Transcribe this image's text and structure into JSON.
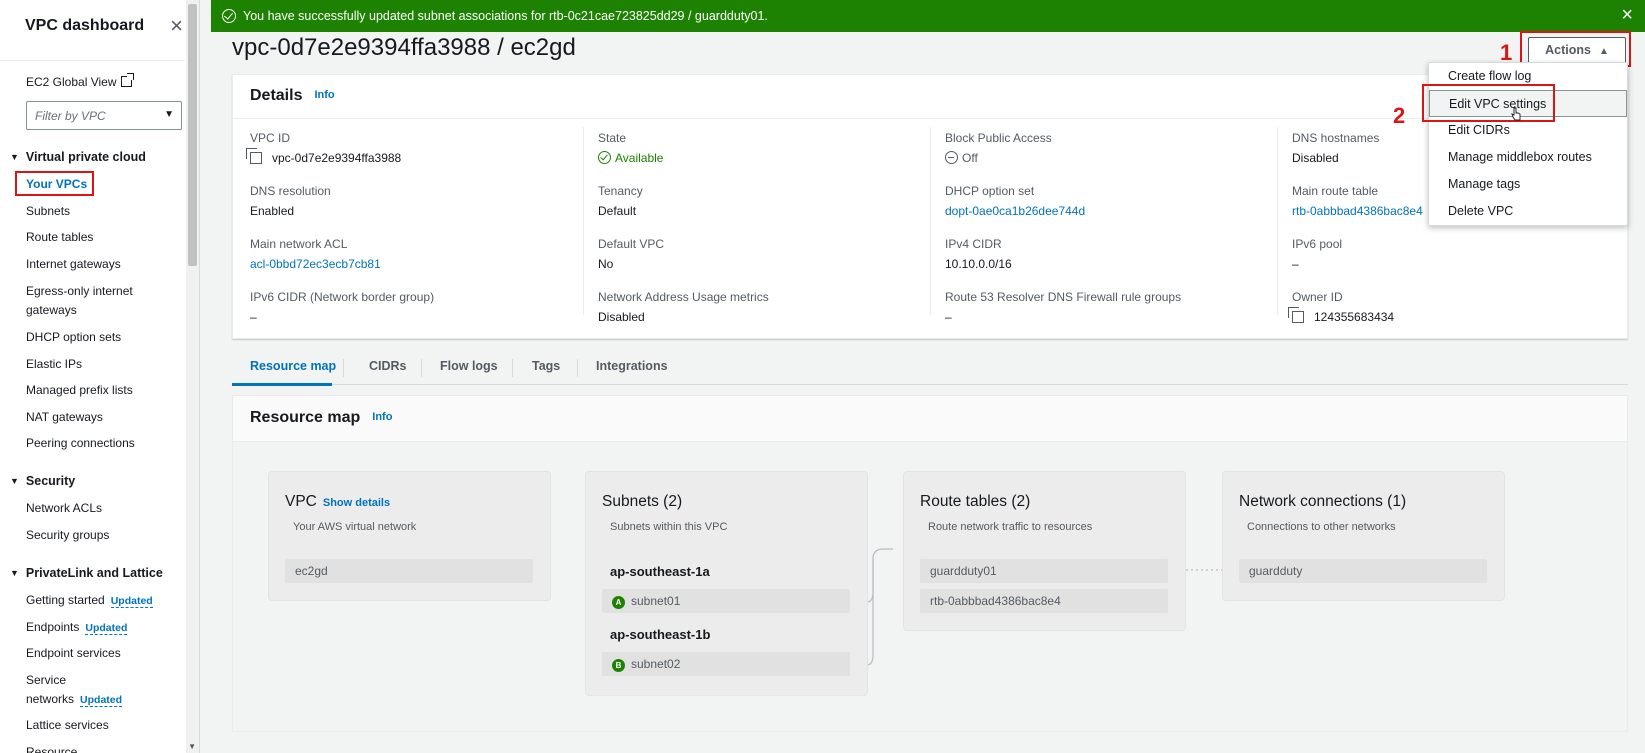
{
  "sidebar": {
    "title": "VPC dashboard",
    "ec2_global_view": "EC2 Global View",
    "filter_placeholder": "Filter by VPC",
    "sections": [
      {
        "title": "Virtual private cloud",
        "items": [
          "Your VPCs",
          "Subnets",
          "Route tables",
          "Internet gateways",
          "Egress-only internet",
          "gateways",
          "DHCP option sets",
          "Elastic IPs",
          "Managed prefix lists",
          "NAT gateways",
          "Peering connections"
        ]
      },
      {
        "title": "Security",
        "items": [
          "Network ACLs",
          "Security groups"
        ]
      },
      {
        "title": "PrivateLink and Lattice",
        "items": [
          "Getting started",
          "Endpoints",
          "Endpoint services",
          "Service",
          "networks",
          "Lattice services",
          "Resource"
        ]
      }
    ],
    "updated_badge": "Updated"
  },
  "flash": {
    "message": "You have successfully updated subnet associations for rtb-0c21cae723825dd29 / guardduty01.",
    "status_color": "#1d8102"
  },
  "page": {
    "title": "vpc-0d7e2e9394ffa3988 / ec2gd",
    "actions_label": "Actions",
    "step1": "1",
    "step2": "2"
  },
  "actions_menu": {
    "items": [
      "Create flow log",
      "Edit VPC settings",
      "Edit CIDRs",
      "Manage middlebox routes",
      "Manage tags",
      "Delete VPC"
    ]
  },
  "details": {
    "heading": "Details",
    "info": "Info",
    "fields": [
      {
        "label": "VPC ID",
        "value": "vpc-0d7e2e9394ffa3988"
      },
      {
        "label": "State",
        "value": "Available"
      },
      {
        "label": "Block Public Access",
        "value": "Off"
      },
      {
        "label": "DNS hostnames",
        "value": "Disabled"
      },
      {
        "label": "DNS resolution",
        "value": "Enabled"
      },
      {
        "label": "Tenancy",
        "value": "Default"
      },
      {
        "label": "DHCP option set",
        "value": "dopt-0ae0ca1b26dee744d"
      },
      {
        "label": "Main route table",
        "value": "rtb-0abbbad4386bac8e4"
      },
      {
        "label": "Main network ACL",
        "value": "acl-0bbd72ec3ecb7cb81"
      },
      {
        "label": "Default VPC",
        "value": "No"
      },
      {
        "label": "IPv4 CIDR",
        "value": "10.10.0.0/16"
      },
      {
        "label": "IPv6 pool",
        "value": "–"
      },
      {
        "label": "IPv6 CIDR (Network border group)",
        "value": "–"
      },
      {
        "label": "Network Address Usage metrics",
        "value": "Disabled"
      },
      {
        "label": "Route 53 Resolver DNS Firewall rule groups",
        "value": "–"
      },
      {
        "label": "Owner ID",
        "value": "124355683434"
      }
    ]
  },
  "tabs": [
    "Resource map",
    "CIDRs",
    "Flow logs",
    "Tags",
    "Integrations"
  ],
  "resource_map": {
    "heading": "Resource map",
    "info": "Info",
    "vpc": {
      "title": "VPC",
      "show_details": "Show details",
      "subtitle": "Your AWS virtual network",
      "item": "ec2gd"
    },
    "subnets": {
      "title": "Subnets (2)",
      "subtitle": "Subnets within this VPC",
      "az1": "ap-southeast-1a",
      "az1_badge": "A",
      "subnet1": "subnet01",
      "az2": "ap-southeast-1b",
      "az2_badge": "B",
      "subnet2": "subnet02"
    },
    "route_tables": {
      "title": "Route tables (2)",
      "subtitle": "Route network traffic to resources",
      "items": [
        "guardduty01",
        "rtb-0abbbad4386bac8e4"
      ]
    },
    "network_connections": {
      "title": "Network connections (1)",
      "subtitle": "Connections to other networks",
      "items": [
        "guardduty"
      ]
    }
  }
}
